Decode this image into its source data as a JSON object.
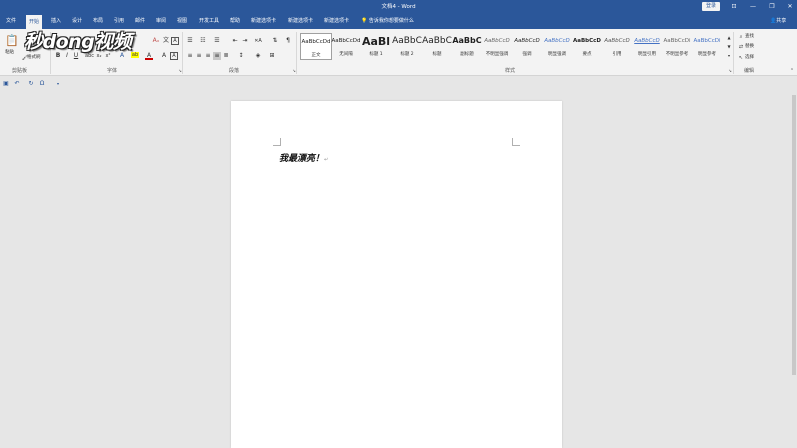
{
  "window": {
    "title": "文档4 - Word",
    "login_label": "登录",
    "controls": [
      "⊡",
      "—",
      "❐",
      "✕"
    ]
  },
  "tabs": [
    {
      "label": "文件",
      "active": false
    },
    {
      "label": "开始",
      "active": true
    },
    {
      "label": "插入",
      "active": false
    },
    {
      "label": "设计",
      "active": false
    },
    {
      "label": "布局",
      "active": false
    },
    {
      "label": "引用",
      "active": false
    },
    {
      "label": "邮件",
      "active": false
    },
    {
      "label": "审阅",
      "active": false
    },
    {
      "label": "视图",
      "active": false
    },
    {
      "label": "开发工具",
      "active": false
    },
    {
      "label": "帮助",
      "active": false
    },
    {
      "label": "新建选项卡",
      "active": false
    },
    {
      "label": "新建选项卡",
      "active": false
    },
    {
      "label": "新建选项卡",
      "active": false
    }
  ],
  "tell_me": "告诉我你想要做什么",
  "share_label": "共享",
  "ribbon": {
    "clipboard": {
      "paste_label": "粘贴",
      "format_painter_label": "格式刷",
      "group_label": "剪贴板"
    },
    "font": {
      "group_label": "字体",
      "bold": "B",
      "italic": "I",
      "underline": "U"
    },
    "paragraph": {
      "group_label": "段落"
    },
    "styles": {
      "group_label": "样式",
      "items": [
        {
          "sample": "AaBbCcDd",
          "name": "正文"
        },
        {
          "sample": "AaBbCcDd",
          "name": "无间隔"
        },
        {
          "sample": "AaBl",
          "name": "标题 1"
        },
        {
          "sample": "AaBbC",
          "name": "标题 2"
        },
        {
          "sample": "AaBbC",
          "name": "标题"
        },
        {
          "sample": "AaBbC",
          "name": "副标题"
        },
        {
          "sample": "AaBbCcD",
          "name": "不明显强调"
        },
        {
          "sample": "AaBbCcD",
          "name": "强调"
        },
        {
          "sample": "AaBbCcD",
          "name": "明显强调"
        },
        {
          "sample": "AaBbCcD",
          "name": "要点"
        },
        {
          "sample": "AaBbCcD",
          "name": "引用"
        },
        {
          "sample": "AaBbCcD",
          "name": "明显引用"
        },
        {
          "sample": "AaBbCcDi",
          "name": "不明显参考"
        },
        {
          "sample": "AaBbCcDi",
          "name": "明显参考"
        }
      ]
    },
    "editing": {
      "group_label": "编辑",
      "find_label": "查找",
      "replace_label": "替换",
      "select_label": "选择"
    }
  },
  "watermark": "秒dong视频",
  "document": {
    "text": "我最漂亮！",
    "paragraph_mark": "↵"
  },
  "colors": {
    "brand": "#2b579a",
    "ribbon_bg": "#f3f3f3",
    "canvas_bg": "#e6e6e6"
  }
}
